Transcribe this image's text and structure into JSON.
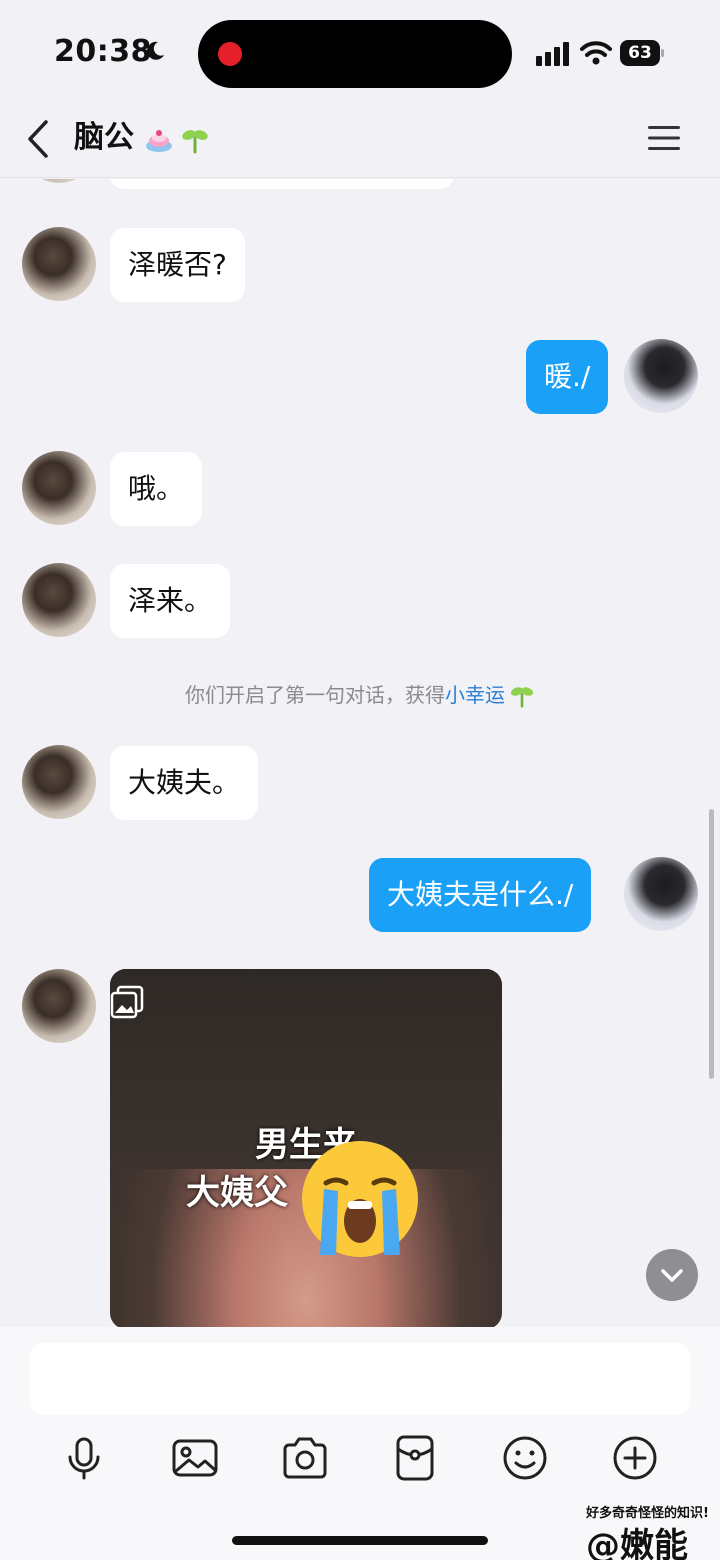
{
  "status_bar": {
    "time": "20:38",
    "battery": "63"
  },
  "header": {
    "title": "脑公"
  },
  "messages": [
    {
      "from": "them",
      "text": "泽暖否?"
    },
    {
      "from": "me",
      "text": "暖./"
    },
    {
      "from": "them",
      "text": "哦。"
    },
    {
      "from": "them",
      "text": "泽来。"
    },
    {
      "from": "them",
      "text": "大姨夫。"
    },
    {
      "from": "me",
      "text": "大姨夫是什么./"
    }
  ],
  "system_message": {
    "prefix": "你们开启了第一句对话，获得",
    "highlight": "小幸运"
  },
  "image_message": {
    "line1": "男生来",
    "line2": "大姨父",
    "emoji": "loudly-crying-face"
  },
  "icons": {
    "back": "chevron-left-icon",
    "menu": "hamburger-menu-icon",
    "tools": [
      "microphone-icon",
      "image-icon",
      "camera-icon",
      "red-packet-icon",
      "emoji-icon",
      "plus-icon"
    ]
  },
  "colors": {
    "my_bubble": "#1aa0f7",
    "their_bubble": "#ffffff",
    "background": "#f2f2f6",
    "link": "#2c7fd6"
  },
  "watermark": {
    "line1": "好多奇奇怪怪的知识!",
    "line2": "@嫩能"
  }
}
